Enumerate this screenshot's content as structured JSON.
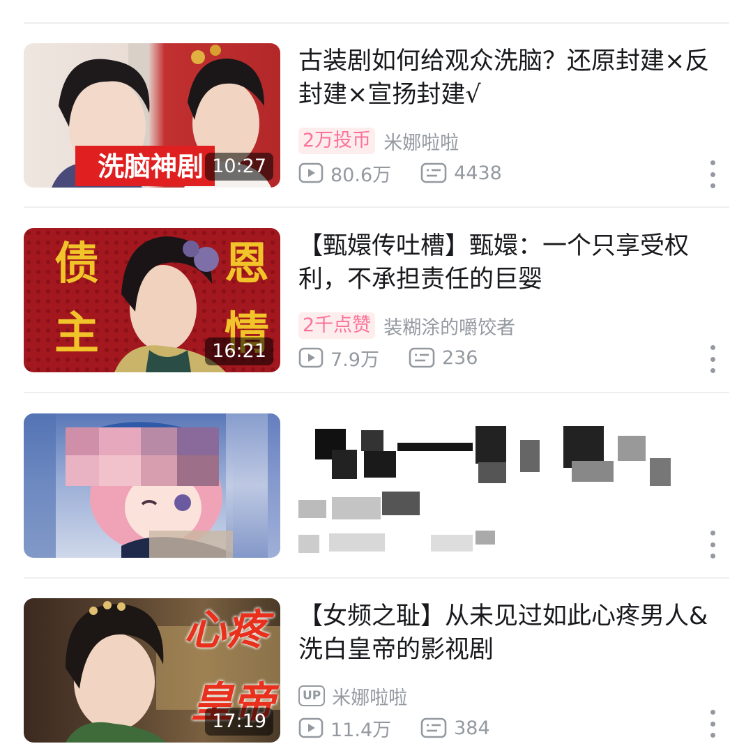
{
  "videos": [
    {
      "title": "古装剧如何给观众洗脑？还原封建×反封建×宣扬封建√",
      "badge": "2万投币",
      "author": "米娜啦啦",
      "duration": "10:27",
      "views": "80.6万",
      "danmaku": "4438",
      "thumb_caption": "洗脑神剧"
    },
    {
      "title": "【甄嬛传吐槽】甄嬛：一个只享受权利，不承担责任的巨婴",
      "badge": "2千点赞",
      "author": "装糊涂的嚼饺者",
      "duration": "16:21",
      "views": "7.9万",
      "danmaku": "236",
      "thumb_chars": [
        "债",
        "恩",
        "主",
        "情"
      ]
    },
    {
      "title": "",
      "author": "",
      "duration": "",
      "views": "",
      "danmaku": ""
    },
    {
      "title": "【女频之耻】从未见过如此心疼男人&洗白皇帝的影视剧",
      "up_label": "UP",
      "author": "米娜啦啦",
      "duration": "17:19",
      "views": "11.4万",
      "danmaku": "384",
      "thumb_chars": [
        "心疼",
        "皇帝"
      ]
    }
  ],
  "icons": {
    "play": "play-count-icon",
    "danmaku": "danmaku-count-icon",
    "more": "more-options-icon"
  },
  "colors": {
    "badge_text": "#fb7299",
    "badge_bg": "#fdeeed",
    "meta": "#9499a0",
    "title": "#18191c"
  }
}
